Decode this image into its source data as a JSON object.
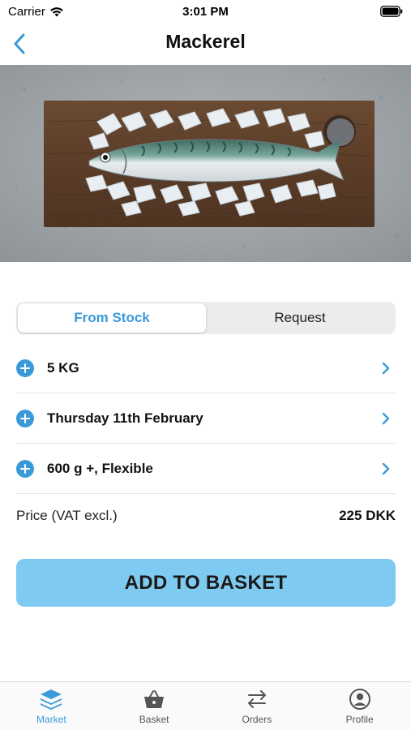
{
  "status_bar": {
    "carrier": "Carrier",
    "time": "3:01 PM"
  },
  "nav": {
    "title": "Mackerel",
    "back_icon": "chevron-left-icon"
  },
  "hero_image": {
    "subject": "mackerel-on-ice-board"
  },
  "segmented": {
    "options": [
      "From Stock",
      "Request"
    ],
    "selected": "From Stock"
  },
  "options": [
    {
      "label": "5 KG",
      "icon": "plus-circle-icon"
    },
    {
      "label": "Thursday 11th February",
      "icon": "plus-circle-icon"
    },
    {
      "label": "600 g +, Flexible",
      "icon": "plus-circle-icon"
    }
  ],
  "price": {
    "label": "Price (VAT excl.)",
    "value": "225 DKK"
  },
  "add_button": {
    "label": "ADD TO BASKET"
  },
  "tabs": [
    {
      "label": "Market",
      "icon": "layers-icon",
      "active": true
    },
    {
      "label": "Basket",
      "icon": "basket-icon",
      "active": false
    },
    {
      "label": "Orders",
      "icon": "swap-arrows-icon",
      "active": false
    },
    {
      "label": "Profile",
      "icon": "person-circle-icon",
      "active": false
    }
  ],
  "colors": {
    "accent": "#3a9ad9",
    "button": "#7fcaf0",
    "segment_bg": "#ececee"
  }
}
